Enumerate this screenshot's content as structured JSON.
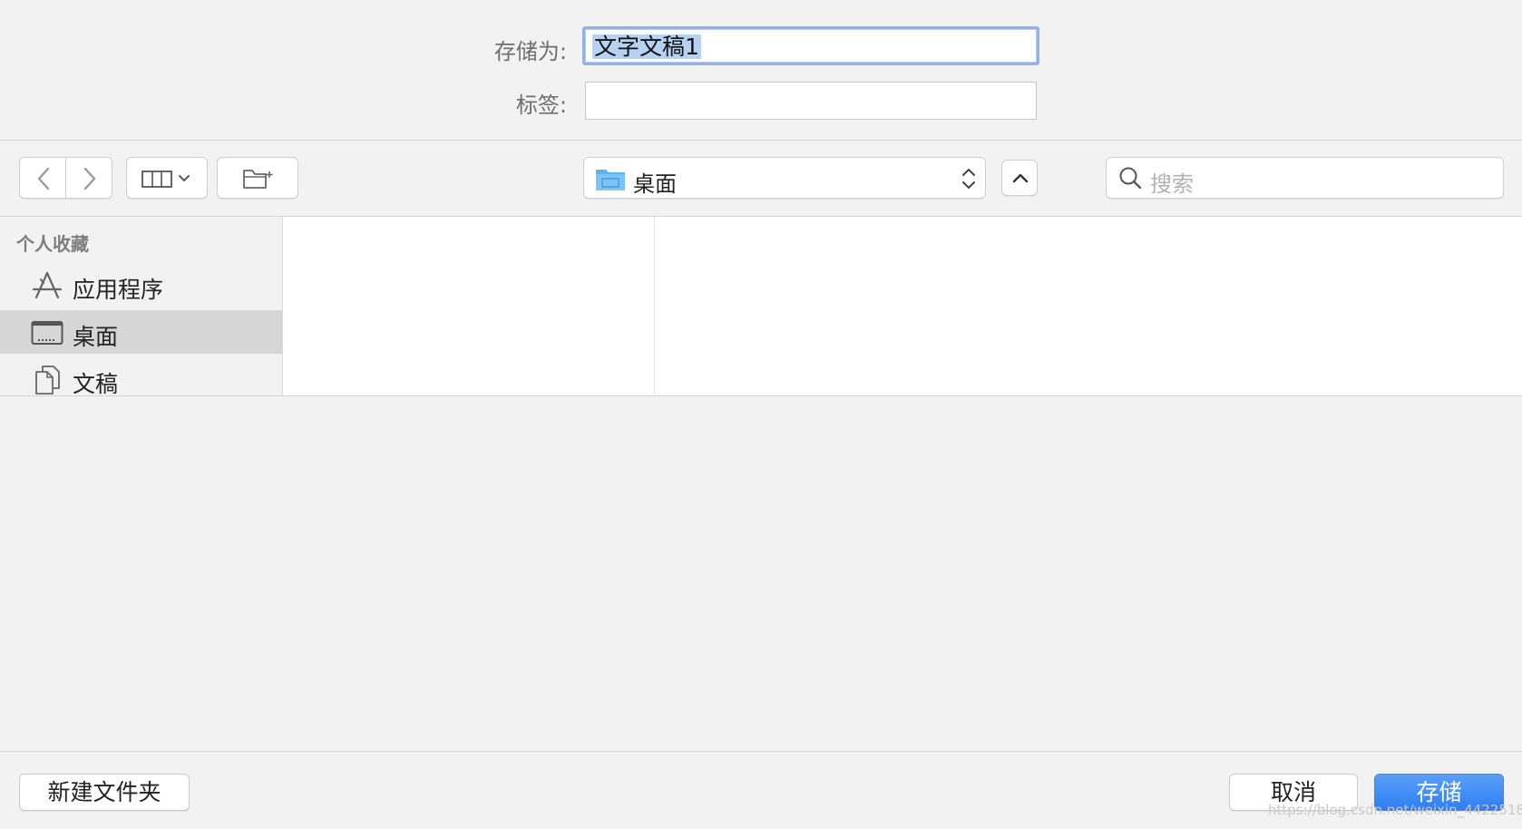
{
  "header": {
    "save_as_label": "存储为:",
    "save_as_value": "文字文稿1",
    "tags_label": "标签:",
    "tags_value": ""
  },
  "toolbar": {
    "back_icon": "chevron-left-icon",
    "forward_icon": "chevron-right-icon",
    "view_icon": "column-view-icon",
    "new_folder_icon": "new-folder-icon",
    "location": "桌面",
    "search_placeholder": "搜索"
  },
  "sidebar": {
    "section_title": "个人收藏",
    "items": [
      {
        "label": "应用程序",
        "icon": "applications-icon",
        "selected": false
      },
      {
        "label": "桌面",
        "icon": "desktop-icon",
        "selected": true
      },
      {
        "label": "文稿",
        "icon": "documents-icon",
        "selected": false
      }
    ]
  },
  "footer": {
    "new_folder_label": "新建文件夹",
    "cancel_label": "取消",
    "save_label": "存储"
  },
  "watermark": "https://blog.csdn.net/weixin_44225182",
  "colors": {
    "accent": "#2f7ef2",
    "selection": "#b7d1f2",
    "focus_ring": "#8fb2ea",
    "folder": "#5bb3f0"
  }
}
